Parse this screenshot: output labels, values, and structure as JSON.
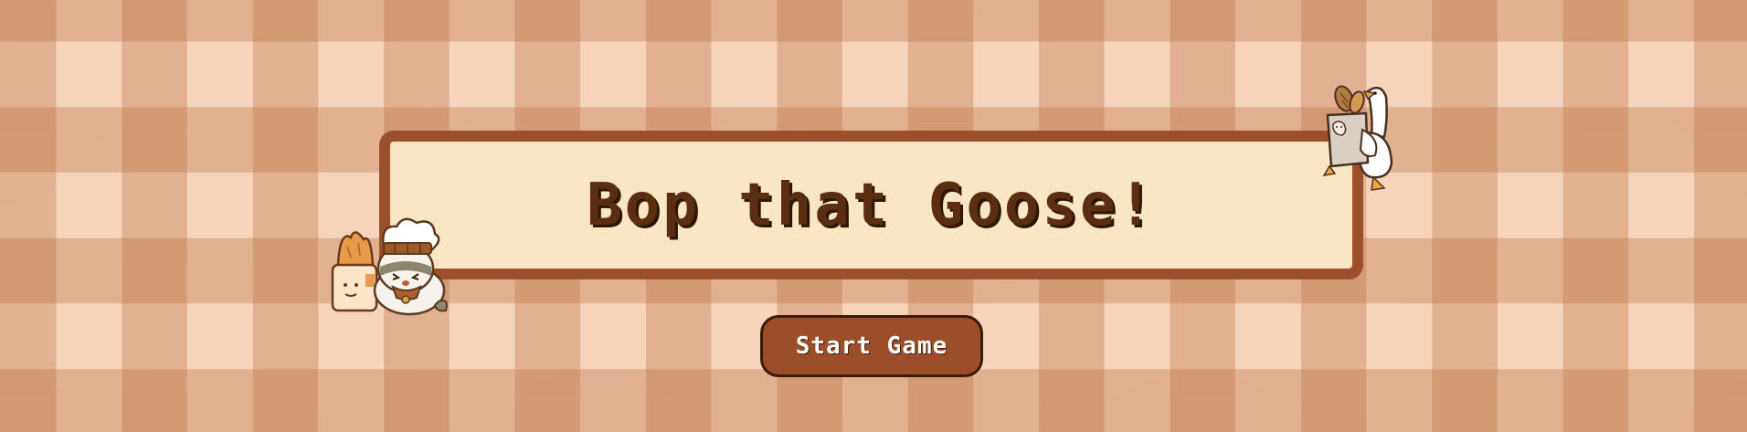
{
  "game": {
    "title": "Bop that Goose!",
    "start_label": "Start Game"
  },
  "colors": {
    "panel_fill": "#f9e7c3",
    "panel_border": "#9b4f2a",
    "title_text": "#5a2e0f",
    "button_fill": "#9c4e2a",
    "button_text": "#ffffff",
    "background_light": "#f6d3bb",
    "background_dark": "#d9a07a"
  },
  "icons": {
    "chef_mascot": "chef-hamster-with-bread-icon",
    "goose_mascot": "goose-carrying-bread-bag-icon"
  }
}
